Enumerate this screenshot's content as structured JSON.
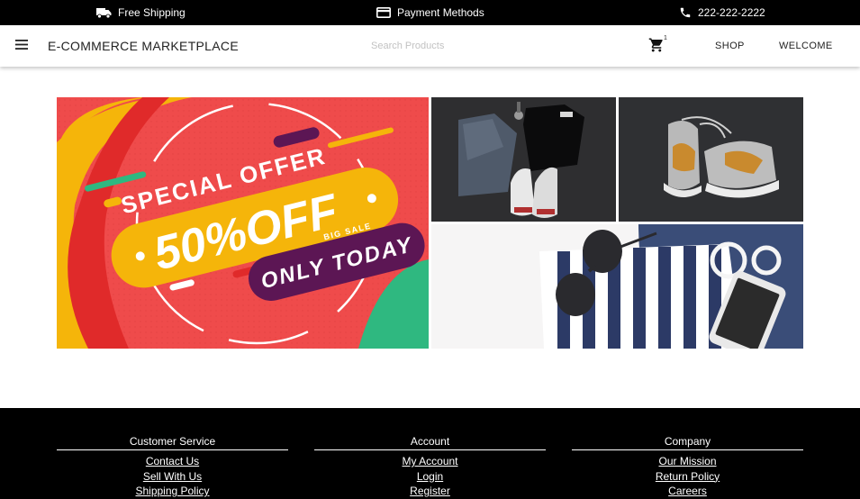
{
  "topbar": {
    "shipping": {
      "label": "Free Shipping",
      "icon": "truck-icon"
    },
    "payment": {
      "label": "Payment Methods",
      "icon": "credit-card-icon"
    },
    "phone": {
      "label": "222-222-2222",
      "icon": "phone-icon"
    }
  },
  "nav": {
    "brand": "E-COMMERCE MARKETPLACE",
    "search_placeholder": "Search Products",
    "cart_count": "1",
    "links": [
      "SHOP",
      "WELCOME"
    ]
  },
  "hero": {
    "banner": {
      "line1": "SPECIAL OFFER",
      "headline": "50%OFF",
      "tag": "BIG SALE",
      "line3": "ONLY TODAY"
    },
    "photos": [
      "clothes-flatlay",
      "sneakers",
      "sunglasses-phone-flatlay"
    ]
  },
  "footer": {
    "columns": [
      {
        "title": "Customer Service",
        "links": [
          "Contact Us",
          "Sell With Us",
          "Shipping Policy"
        ]
      },
      {
        "title": "Account",
        "links": [
          "My Account",
          "Login",
          "Register"
        ]
      },
      {
        "title": "Company",
        "links": [
          "Our Mission",
          "Return Policy",
          "Careers"
        ]
      }
    ]
  },
  "colors": {
    "topbar_bg": "#000000",
    "footer_bg": "#000000",
    "banner_red": "#ef4b4b",
    "banner_yellow": "#f5b50a",
    "banner_purple": "#5c1654"
  }
}
